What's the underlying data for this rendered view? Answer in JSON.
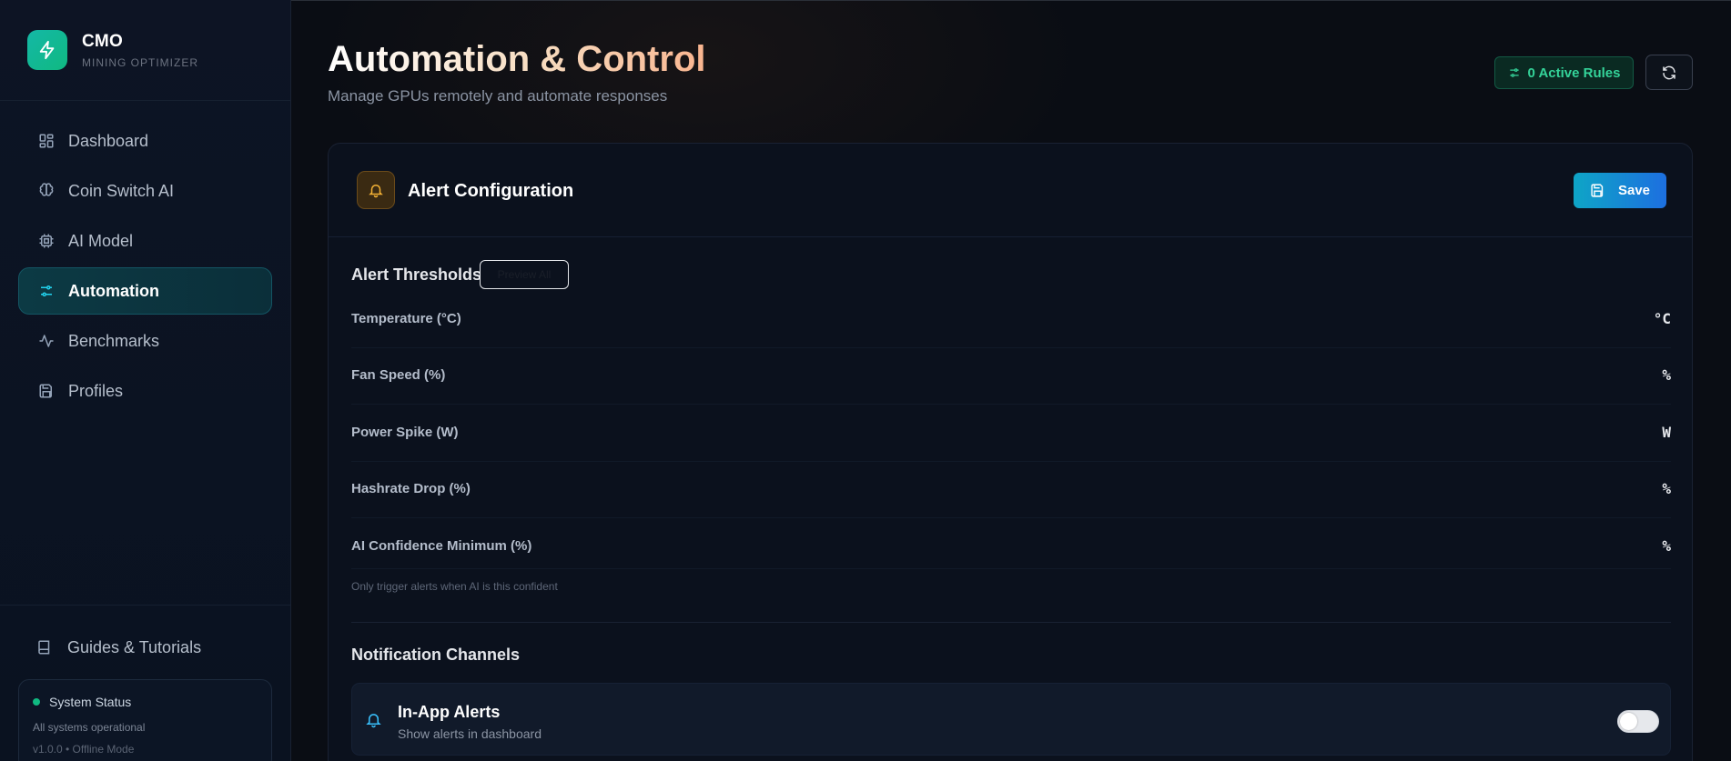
{
  "brand": {
    "title": "CMO",
    "subtitle": "MINING OPTIMIZER"
  },
  "sidebar": {
    "items": [
      {
        "label": "Dashboard",
        "icon": "dashboard-grid-icon"
      },
      {
        "label": "Coin Switch AI",
        "icon": "brain-icon"
      },
      {
        "label": "AI Model",
        "icon": "cpu-chip-icon"
      },
      {
        "label": "Automation",
        "icon": "sliders-icon",
        "active": true
      },
      {
        "label": "Benchmarks",
        "icon": "activity-pulse-icon"
      },
      {
        "label": "Profiles",
        "icon": "floppy-disk-icon"
      }
    ],
    "guides_label": "Guides & Tutorials",
    "status": {
      "title": "System Status",
      "message": "All systems operational",
      "version": "v1.0.0 • Offline Mode"
    }
  },
  "header": {
    "title": "Automation & Control",
    "subtitle": "Manage GPUs remotely and automate responses",
    "active_rules_label": "0 Active Rules"
  },
  "alert_card": {
    "title": "Alert Configuration",
    "save_label": "Save",
    "thresholds_heading": "Alert Thresholds",
    "preview_label": "Preview All",
    "thresholds": [
      {
        "label": "Temperature (°C)",
        "unit": "°C"
      },
      {
        "label": "Fan Speed (%)",
        "unit": "%"
      },
      {
        "label": "Power Spike (W)",
        "unit": "W"
      },
      {
        "label": "Hashrate Drop (%)",
        "unit": "%"
      },
      {
        "label": "AI Confidence Minimum (%)",
        "unit": "%"
      }
    ],
    "confidence_hint": "Only trigger alerts when AI is this confident",
    "channels_heading": "Notification Channels",
    "channels": [
      {
        "title": "In-App Alerts",
        "subtitle": "Show alerts in dashboard",
        "enabled": false
      }
    ]
  },
  "colors": {
    "accent_teal": "#14b8a6",
    "active_green": "#34d399",
    "save_blue": "#1d6fe0",
    "warning_amber": "#f59e0b"
  }
}
